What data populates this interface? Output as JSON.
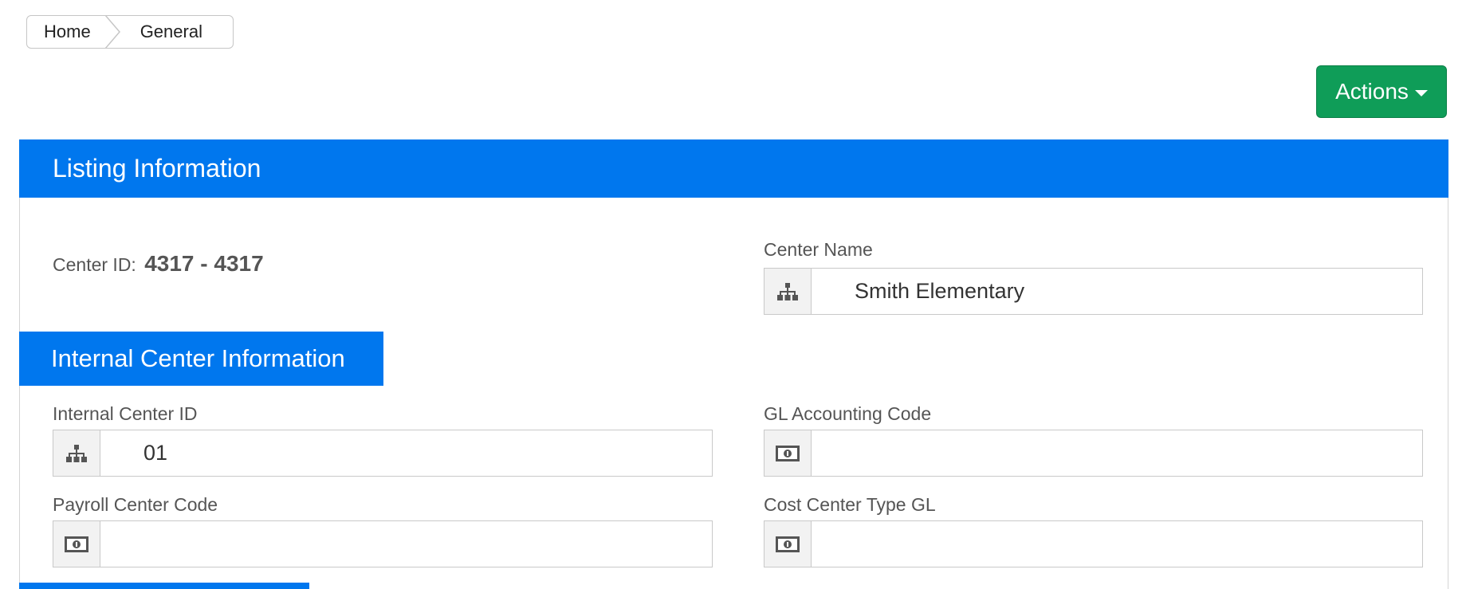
{
  "breadcrumb": {
    "home": "Home",
    "current": "General"
  },
  "actions": {
    "label": "Actions"
  },
  "listing": {
    "title": "Listing Information",
    "center_id_label": "Center ID:",
    "center_id_value": "4317 - 4317",
    "center_name_label": "Center Name",
    "center_name_value": "Smith Elementary"
  },
  "internal": {
    "title": "Internal Center Information",
    "internal_center_id_label": "Internal Center ID",
    "internal_center_id_value": "01",
    "gl_accounting_code_label": "GL Accounting Code",
    "gl_accounting_code_value": "",
    "payroll_center_code_label": "Payroll Center Code",
    "payroll_center_code_value": "",
    "cost_center_type_gl_label": "Cost Center Type GL",
    "cost_center_type_gl_value": ""
  },
  "icons": {
    "org": "sitemap-icon",
    "money": "money-icon"
  },
  "colors": {
    "header_blue": "#0077ee",
    "actions_green": "#0f9d58"
  }
}
